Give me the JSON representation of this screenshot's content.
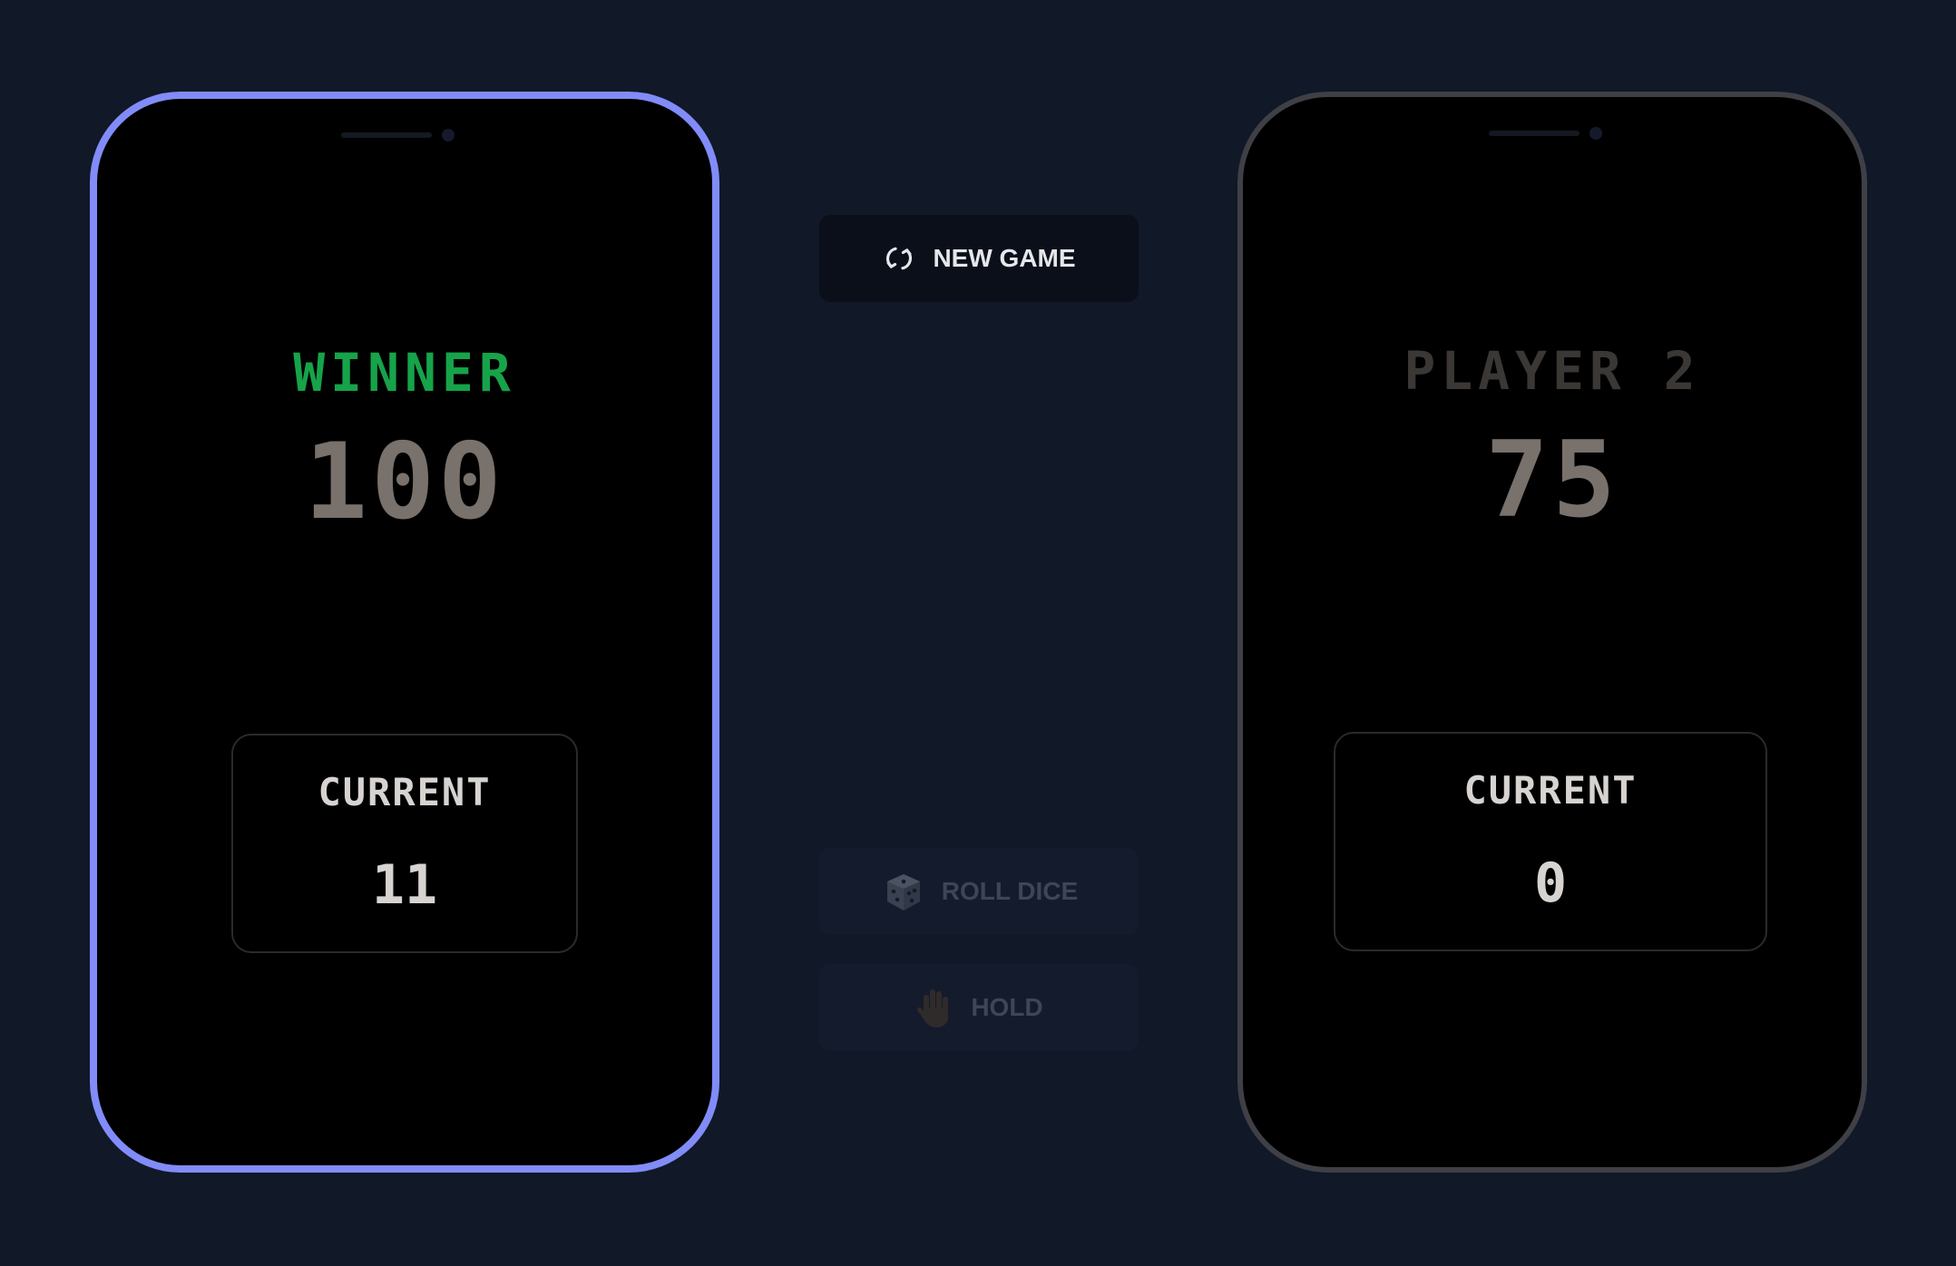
{
  "colors": {
    "background": "#111827",
    "active_border": "#818cf8",
    "inactive_border": "#3f3f46",
    "winner_text": "#16a34a",
    "player2_text": "#3a3734",
    "score_text": "#78716c"
  },
  "players": [
    {
      "name": "WINNER",
      "score": "100",
      "current_label": "CURRENT",
      "current": "11",
      "active": true,
      "winner": true
    },
    {
      "name": "PLAYER 2",
      "score": "75",
      "current_label": "CURRENT",
      "current": "0",
      "active": false,
      "winner": false
    }
  ],
  "controls": {
    "new_game": {
      "label": "NEW GAME",
      "icon": "refresh-icon",
      "enabled": true
    },
    "roll_dice": {
      "label": "ROLL DICE",
      "icon": "dice-icon",
      "enabled": false
    },
    "hold": {
      "label": "HOLD",
      "icon": "hand-icon",
      "enabled": false
    }
  }
}
